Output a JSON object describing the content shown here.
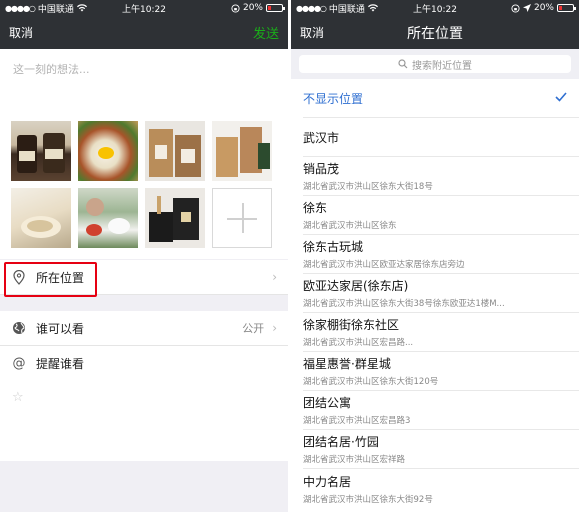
{
  "status": {
    "carrier": "中国联通",
    "time": "上午10:22",
    "battery": "20%",
    "battery_level": 0.2
  },
  "left": {
    "nav": {
      "cancel": "取消",
      "send": "发送"
    },
    "compose_placeholder": "这一刻的想法...",
    "photo_count": 7,
    "location_label": "所在位置",
    "who_can_see_label": "谁可以看",
    "who_can_see_value": "公开",
    "remind_label": "提醒谁看"
  },
  "right": {
    "nav": {
      "cancel": "取消",
      "title": "所在位置"
    },
    "search_placeholder": "搜索附近位置",
    "places": [
      {
        "name": "不显示位置",
        "addr": ""
      },
      {
        "name": "武汉市",
        "addr": ""
      },
      {
        "name": "销品茂",
        "addr": "湖北省武汉市洪山区徐东大街18号"
      },
      {
        "name": "徐东",
        "addr": "湖北省武汉市洪山区徐东"
      },
      {
        "name": "徐东古玩城",
        "addr": "湖北省武汉市洪山区欧亚达家居徐东店旁边"
      },
      {
        "name": "欧亚达家居(徐东店)",
        "addr": "湖北省武汉市洪山区徐东大街38号徐东欧亚达1楼M..."
      },
      {
        "name": "徐家棚街徐东社区",
        "addr": "湖北省武汉市洪山区宏昌路..."
      },
      {
        "name": "福星惠誉·群星城",
        "addr": "湖北省武汉市洪山区徐东大街120号"
      },
      {
        "name": "团结公寓",
        "addr": "湖北省武汉市洪山区宏昌路3"
      },
      {
        "name": "团结名居·竹园",
        "addr": "湖北省武汉市洪山区宏祥路"
      },
      {
        "name": "中力名居",
        "addr": "湖北省武汉市洪山区徐东大街92号"
      }
    ]
  },
  "colors": {
    "navbar": "#2e3135",
    "send": "#1aad19",
    "selected": "#2f6fd1",
    "highlight": "#e60012"
  },
  "icons": {
    "location": "location-pin-icon",
    "globe": "globe-icon",
    "at": "at-sign-icon",
    "star": "star-icon",
    "search": "search-icon",
    "check": "checkmark-icon",
    "chevron": "chevron-right-icon"
  }
}
